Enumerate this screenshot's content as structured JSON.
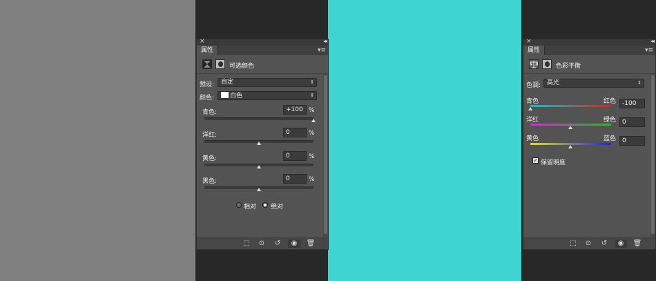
{
  "selective_color_panel": {
    "tab_label": "属性",
    "title": "可选颜色",
    "preset_label": "预设:",
    "preset_value": "自定",
    "colors_label": "颜色:",
    "colors_value": "白色",
    "sliders": [
      {
        "label": "青色:",
        "value": "+100",
        "unit": "%",
        "position": 1.0
      },
      {
        "label": "洋红:",
        "value": "0",
        "unit": "%",
        "position": 0.5
      },
      {
        "label": "黄色:",
        "value": "0",
        "unit": "%",
        "position": 0.5
      },
      {
        "label": "黑色:",
        "value": "0",
        "unit": "%",
        "position": 0.5
      }
    ],
    "method_relative_label": "相对",
    "method_absolute_label": "绝对",
    "method_selected": "绝对"
  },
  "color_balance_panel": {
    "tab_label": "属性",
    "title": "色彩平衡",
    "tone_label": "色调:",
    "tone_value": "高光",
    "sliders": [
      {
        "left": "青色",
        "right": "红色",
        "value": "-100",
        "position": 0.0,
        "left_color": "#00c8c8",
        "right_color": "#e02020"
      },
      {
        "left": "洋红",
        "right": "绿色",
        "value": "0",
        "position": 0.5,
        "left_color": "#e020e0",
        "right_color": "#20c020"
      },
      {
        "left": "黄色",
        "right": "蓝色",
        "value": "0",
        "position": 0.5,
        "left_color": "#e0e020",
        "right_color": "#2020e0"
      }
    ],
    "preserve_luminosity_label": "保留明度",
    "preserve_luminosity_checked": true
  },
  "canvas_color": "#3dd4d1"
}
